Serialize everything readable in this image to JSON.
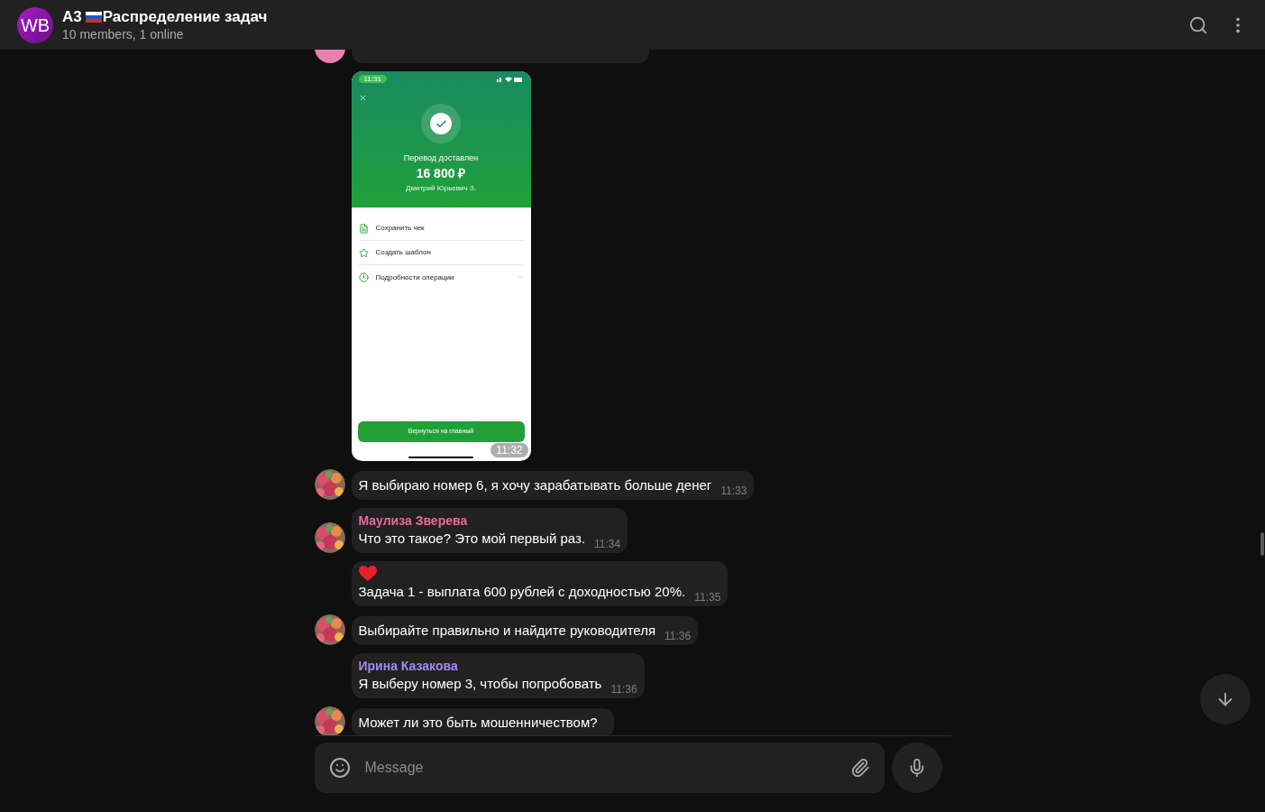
{
  "header": {
    "avatar_text": "WB",
    "title_prefix": "А3",
    "title": "Распределение задач",
    "subtitle": "10 members, 1 online"
  },
  "messages": [
    {
      "kind": "hidden",
      "avatar": {
        "kind": "color",
        "color": "#e87fb0"
      }
    },
    {
      "time": "11:32",
      "photo": {
        "status_time": "11:31",
        "status": "Перевод доставлен",
        "amount": "16 800 ₽",
        "recipient": "Дмитрий Юрьевич З.",
        "actions": [
          {
            "kind": "receipt",
            "label": "Сохранить чек"
          },
          {
            "kind": "template",
            "label": "Создать шаблон"
          },
          {
            "kind": "details",
            "label": "Подробности операции"
          }
        ],
        "button": "Вернуться на главный"
      }
    },
    {
      "kind": "text",
      "text": "Я выбираю номер 6, я хочу зарабатывать больше денег",
      "time": "11:33"
    },
    {
      "kind": "text",
      "sender": "Маулиза Зверева",
      "color": "#e8699f",
      "text": "Что это такое? Это мой первый раз.",
      "time": "11:34"
    },
    {
      "kind": "text",
      "heart": true,
      "text": "Задача 1 - выплата 600 рублей с доходностью 20%.",
      "time": "11:35"
    },
    {
      "kind": "text",
      "text": "Выбирайте правильно и найдите руководителя",
      "time": "11:36"
    },
    {
      "kind": "text",
      "sender": "Ирина Казакова",
      "color": "#a08cf0",
      "text": "Я выберу номер 3, чтобы попробовать",
      "time": "11:36"
    },
    {
      "kind": "text",
      "text": "Может ли это быть мошенничеством?"
    }
  ],
  "composer": {
    "placeholder": "Message"
  }
}
